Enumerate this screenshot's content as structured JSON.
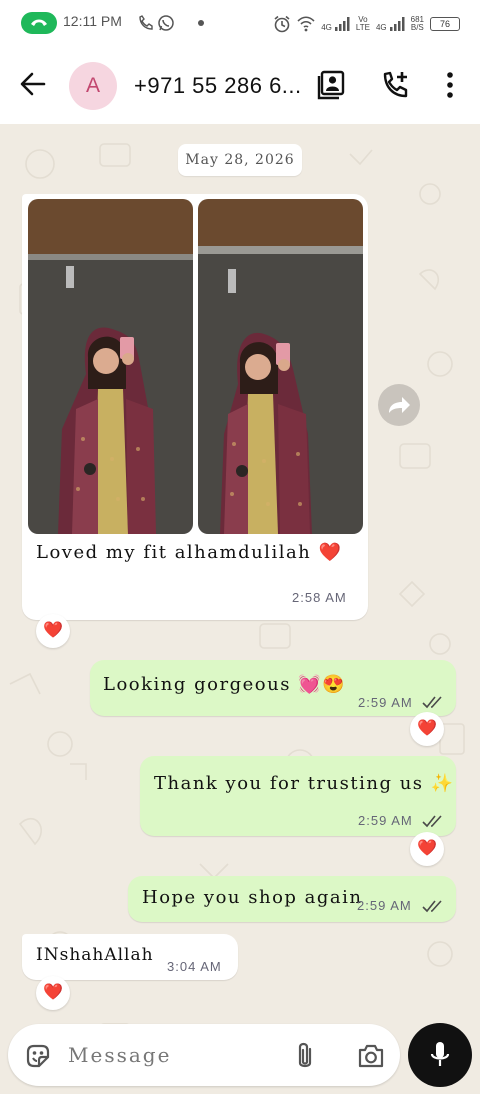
{
  "status_bar": {
    "time": "12:11 PM",
    "network_1": "4G",
    "network_2_top": "Vo",
    "network_2_bottom": "LTE",
    "network_3": "4G",
    "speed_value": "681",
    "speed_unit": "B/S",
    "battery": "76"
  },
  "header": {
    "avatar_letter": "A",
    "contact_name": "+971 55 286 6..."
  },
  "chat": {
    "date_chip": "May 28, 2026",
    "messages": [
      {
        "direction": "incoming",
        "type": "images",
        "caption": "Loved my fit alhamdulilah ❤️",
        "time": "2:58 AM",
        "reaction": "❤️"
      },
      {
        "direction": "outgoing",
        "text": "Looking gorgeous 💓😍",
        "time": "2:59 AM",
        "status": "read",
        "reaction": "❤️"
      },
      {
        "direction": "outgoing",
        "text": "Thank you for trusting us ✨",
        "time": "2:59 AM",
        "status": "read",
        "reaction": "❤️"
      },
      {
        "direction": "outgoing",
        "text": "Hope you shop again",
        "time": "2:59 AM",
        "status": "read"
      },
      {
        "direction": "incoming",
        "text": "INshahAllah",
        "time": "3:04 AM",
        "reaction": "❤️"
      }
    ]
  },
  "composer": {
    "placeholder": "Message"
  },
  "colors": {
    "accent_green": "#1fb85a",
    "outgoing_bubble": "#dcf8c6",
    "incoming_bubble": "#ffffff",
    "chat_background": "#f0ebe2",
    "read_ticks": "#4a4a4a"
  }
}
